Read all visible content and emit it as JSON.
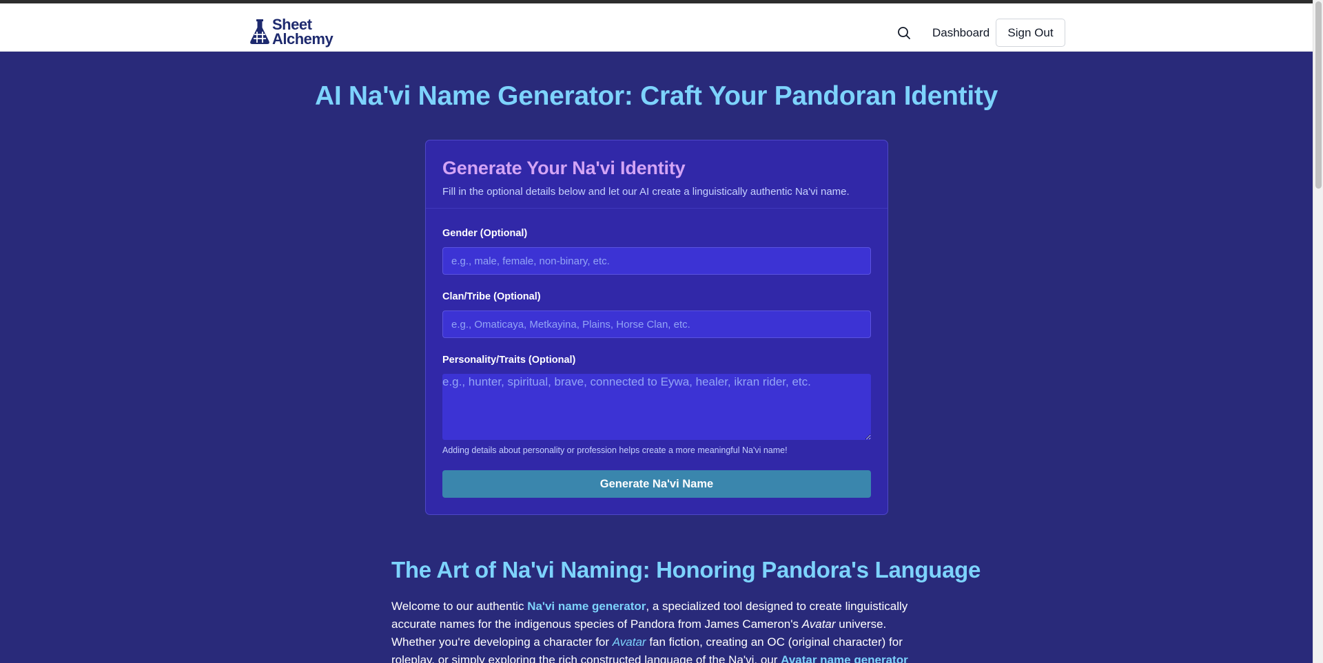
{
  "header": {
    "logo_line1": "Sheet",
    "logo_line2": "Alchemy",
    "nav_dashboard": "Dashboard",
    "sign_out": "Sign Out"
  },
  "page": {
    "title": "AI Na'vi Name Generator: Craft Your Pandoran Identity"
  },
  "form": {
    "title": "Generate Your Na'vi Identity",
    "subtitle": "Fill in the optional details below and let our AI create a linguistically authentic Na'vi name.",
    "gender_label": "Gender (Optional)",
    "gender_placeholder": "e.g., male, female, non-binary, etc.",
    "clan_label": "Clan/Tribe (Optional)",
    "clan_placeholder": "e.g., Omaticaya, Metkayina, Plains, Horse Clan, etc.",
    "traits_label": "Personality/Traits (Optional)",
    "traits_placeholder": "e.g., hunter, spiritual, brave, connected to Eywa, healer, ikran rider, etc.",
    "hint": "Adding details about personality or profession helps create a more meaningful Na'vi name!",
    "submit_label": "Generate Na'vi Name"
  },
  "article": {
    "heading": "The Art of Na'vi Naming: Honoring Pandora's Language",
    "p1_a": "Welcome to our authentic ",
    "p1_link1": "Na'vi name generator",
    "p1_b": ", a specialized tool designed to create linguistically accurate names for the indigenous species of Pandora from James Cameron's ",
    "p1_em1": "Avatar",
    "p1_c": " universe. Whether you're developing a character for ",
    "p1_em2": "Avatar",
    "p1_d": " fan fiction, creating an OC (original character) for roleplay, or simply exploring the rich constructed language of the Na'vi, our ",
    "p1_link2": "Avatar name generator"
  },
  "icons": {
    "search": "search-icon",
    "logo": "flask-grid-icon"
  },
  "colors": {
    "background": "#292a7a",
    "card": "#3128a8",
    "accent_cyan": "#7dd3fc",
    "accent_purple": "#d3a4f5",
    "button": "#3a86ad"
  }
}
